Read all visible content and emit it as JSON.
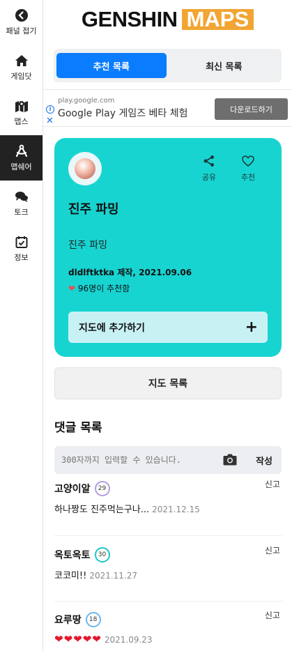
{
  "sidebar": {
    "items": [
      {
        "label": "패널 접기",
        "icon": "chevron-left-circle-icon"
      },
      {
        "label": "게임닷",
        "icon": "home-icon"
      },
      {
        "label": "맵스",
        "icon": "map-pin-icon"
      },
      {
        "label": "맵쉐어",
        "icon": "share-map-icon",
        "active": true
      },
      {
        "label": "토크",
        "icon": "chat-bubbles-icon"
      },
      {
        "label": "정보",
        "icon": "calendar-check-icon"
      }
    ]
  },
  "logo": {
    "word1": "GENSHIN",
    "word2": "MAPS"
  },
  "tabs": [
    {
      "label": "추천 목록",
      "active": true
    },
    {
      "label": "최신 목록",
      "active": false
    }
  ],
  "ad": {
    "url": "play.google.com",
    "title": "Google Play 게임즈 베타 체험",
    "button": "다운로드하기"
  },
  "map_card": {
    "share_label": "공유",
    "recommend_label": "추천",
    "name": "진주 파밍",
    "description": "진주 파밍",
    "meta": "dldlftktka 제작, 2021.09.06",
    "likes": "96명이 추천함",
    "add_button": "지도에 추가하기",
    "bg_color": "#17d4d1"
  },
  "map_list_button": "지도 목록",
  "comments_section": {
    "title": "댓글 목록",
    "placeholder": "300자까지 입력할 수 있습니다.",
    "post_label": "작성",
    "report_label": "신고",
    "items": [
      {
        "user": "고양이알",
        "level": "29",
        "level_color": "#b69be0",
        "text": "하나짱도 진주먹는구나...",
        "date": "2021.12.15"
      },
      {
        "user": "옥토옥토",
        "level": "30",
        "level_color": "#17c7c4",
        "text": "코코미!!",
        "date": "2021.11.27"
      },
      {
        "user": "요루땅",
        "level": "18",
        "level_color": "#6fb6e8",
        "text": "❤❤❤❤❤",
        "date": "2021.09.23"
      }
    ]
  }
}
